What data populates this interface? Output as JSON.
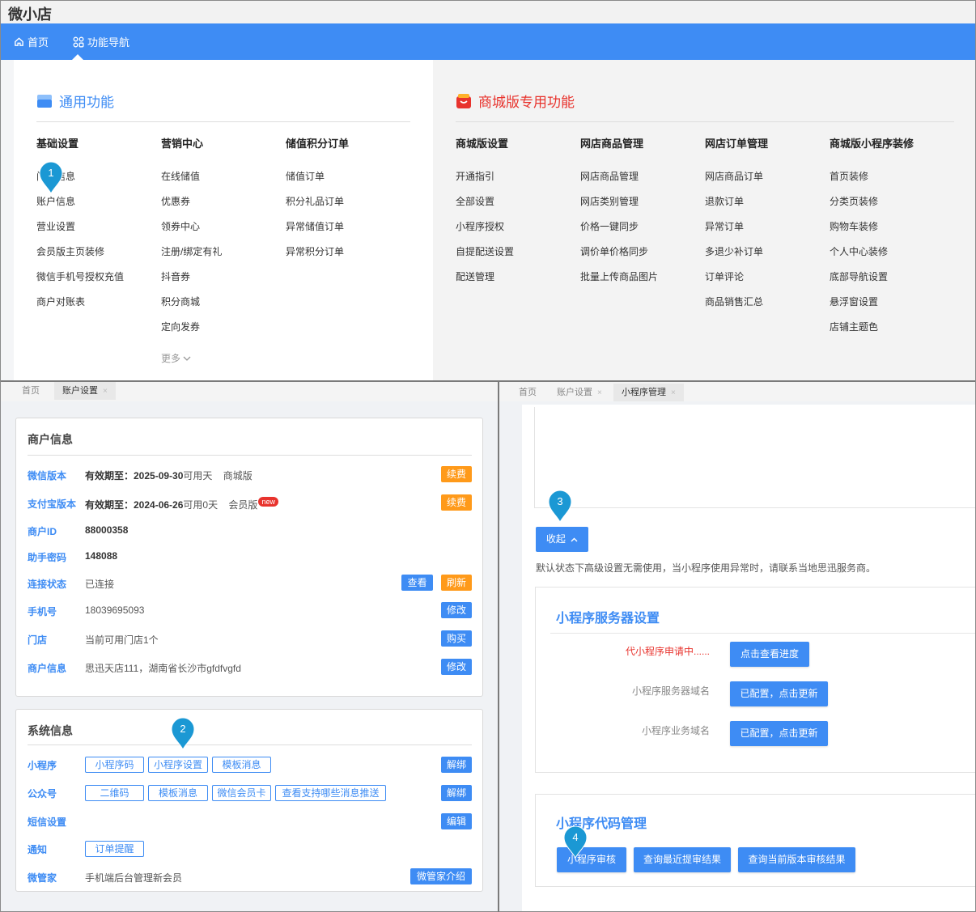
{
  "app": {
    "title": "微小店"
  },
  "nav": {
    "home": "首页",
    "func_nav": "功能导航"
  },
  "mega": {
    "general": {
      "title": "通用功能",
      "columns": [
        {
          "head": "基础设置",
          "items": [
            "门店信息",
            "账户信息",
            "营业设置",
            "会员版主页装修",
            "微信手机号授权充值",
            "商户对账表"
          ]
        },
        {
          "head": "营销中心",
          "items": [
            "在线储值",
            "优惠券",
            "领券中心",
            "注册/绑定有礼",
            "抖音券",
            "积分商城",
            "定向发券"
          ],
          "more": "更多"
        },
        {
          "head": "储值积分订单",
          "items": [
            "储值订单",
            "积分礼品订单",
            "异常储值订单",
            "异常积分订单"
          ]
        }
      ]
    },
    "mall": {
      "title": "商城版专用功能",
      "columns": [
        {
          "head": "商城版设置",
          "items": [
            "开通指引",
            "全部设置",
            "小程序授权",
            "自提配送设置",
            "配送管理"
          ]
        },
        {
          "head": "网店商品管理",
          "items": [
            "网店商品管理",
            "网店类别管理",
            "价格一键同步",
            "调价单价格同步",
            "批量上传商品图片"
          ]
        },
        {
          "head": "网店订单管理",
          "items": [
            "网店商品订单",
            "退款订单",
            "异常订单",
            "多退少补订单",
            "订单评论",
            "商品销售汇总"
          ]
        },
        {
          "head": "商城版小程序装修",
          "items": [
            "首页装修",
            "分类页装修",
            "购物车装修",
            "个人中心装修",
            "底部导航设置",
            "悬浮窗设置",
            "店铺主题色"
          ]
        }
      ]
    }
  },
  "left_panel": {
    "tabs": [
      {
        "label": "首页"
      },
      {
        "label": "账户设置",
        "close": "×"
      }
    ],
    "merchant": {
      "title": "商户信息",
      "wechat_version": {
        "label": "微信版本",
        "expiry": "有效期至：2025-09-30",
        "remaining": "可用天",
        "edition": "商城版",
        "btn": "续费"
      },
      "alipay_version": {
        "label": "支付宝版本",
        "expiry": "有效期至：2024-06-26",
        "remaining": "可用0天",
        "edition": "会员版",
        "badge": "new",
        "btn": "续费"
      },
      "merchant_id": {
        "label": "商户ID",
        "value": "88000358"
      },
      "helper_code": {
        "label": "助手密码",
        "value": "148088"
      },
      "connection": {
        "label": "连接状态",
        "value": "已连接",
        "btn_view": "查看",
        "btn_refresh": "刷新"
      },
      "phone": {
        "label": "手机号",
        "value": "18039695093",
        "btn": "修改"
      },
      "store": {
        "label": "门店",
        "value": "当前可用门店1个",
        "btn": "购买"
      },
      "info": {
        "label": "商户信息",
        "value": "思迅天店111，湖南省长沙市gfdfvgfd",
        "btn": "修改"
      }
    },
    "system": {
      "title": "系统信息",
      "miniapp": {
        "label": "小程序",
        "opts": [
          "小程序码",
          "小程序设置",
          "模板消息"
        ],
        "btn": "解绑"
      },
      "official": {
        "label": "公众号",
        "opts": [
          "二维码",
          "模板消息",
          "微信会员卡",
          "查看支持哪些消息推送"
        ],
        "btn": "解绑"
      },
      "sms": {
        "label": "短信设置",
        "btn": "编辑"
      },
      "notify": {
        "label": "通知",
        "opt": "订单提醒"
      },
      "wgj": {
        "label": "微管家",
        "value": "手机端后台管理新会员",
        "btn": "微管家介绍"
      }
    }
  },
  "right_panel": {
    "tabs": [
      {
        "label": "首页"
      },
      {
        "label": "账户设置",
        "close": "×"
      },
      {
        "label": "小程序管理",
        "close": "×"
      }
    ],
    "collapse_btn": "收起",
    "note": "默认状态下高级设置无需使用，当小程序使用异常时，请联系当地思迅服务商。",
    "server": {
      "title": "小程序服务器设置",
      "status": "代小程序申请中......",
      "btn_progress": "点击查看进度",
      "server_domain": "小程序服务器域名",
      "btn_server": "已配置，点击更新",
      "biz_domain": "小程序业务域名",
      "btn_biz": "已配置，点击更新"
    },
    "code": {
      "title": "小程序代码管理",
      "btn_audit": "小程序审核",
      "btn_latest": "查询最近提审结果",
      "btn_current": "查询当前版本审核结果"
    }
  },
  "markers": [
    "1",
    "2",
    "3",
    "4"
  ],
  "colors": {
    "primary": "#3e8cf4",
    "orange": "#ff9a1a",
    "red": "#e8332d",
    "marker": "#1b98d4"
  }
}
